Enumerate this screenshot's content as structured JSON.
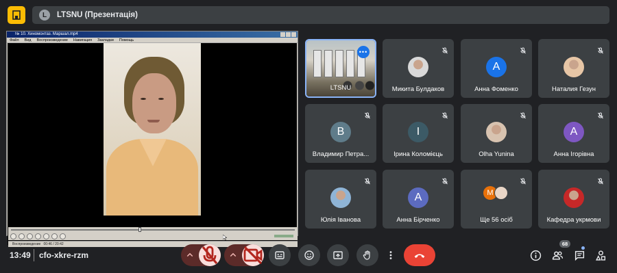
{
  "header": {
    "presenter_initial": "L",
    "presenter_title": "LTSNU (Презентація)"
  },
  "shared_screen": {
    "window_title": "№ 10. Хиномонтаз. Маршал.mp4",
    "menu": [
      "Файл",
      "Вид",
      "Воспроизведение",
      "Навигация",
      "Закладки",
      "Помощь"
    ],
    "status_text": "Воспроизведение",
    "time_text": "00:46 / 20:42"
  },
  "tiles": [
    {
      "name": "LTSNU",
      "type": "room",
      "selected": true,
      "more_label": "•••"
    },
    {
      "name": "Микита Булдаков",
      "type": "photo",
      "photo_color": "#d9d9d9"
    },
    {
      "name": "Анна Фоменко",
      "type": "letter",
      "initial": "A",
      "color": "#1a73e8"
    },
    {
      "name": "Наталия Гезун",
      "type": "photo",
      "photo_color": "#e7c6a6"
    },
    {
      "name": "Владимир Петра...",
      "type": "letter",
      "initial": "B",
      "color": "#5f7c8a"
    },
    {
      "name": "Ірина Коломієць",
      "type": "letter",
      "initial": "I",
      "color": "#3c5a66"
    },
    {
      "name": "Olha Yunina",
      "type": "photo",
      "photo_color": "#d8c3b0"
    },
    {
      "name": "Анна Ігорівна",
      "type": "letter",
      "initial": "A",
      "color": "#7e57c2"
    },
    {
      "name": "Юлія Іванова",
      "type": "photo",
      "photo_color": "#8fb4d6"
    },
    {
      "name": "Анна Бірченко",
      "type": "letter",
      "initial": "A",
      "color": "#5c6bc0"
    },
    {
      "name": "Ще 56 осіб",
      "type": "others",
      "initial": "M"
    },
    {
      "name": "Кафедра укрмови",
      "type": "photo",
      "photo_color": "#c62828"
    }
  ],
  "footer": {
    "time": "13:49",
    "meeting_code": "cfo-xkre-rzm",
    "participants_count": "68"
  },
  "colors": {
    "background": "#202124",
    "tile": "#3c4043",
    "end_call": "#ea4335",
    "accent": "#8ab4f8"
  }
}
